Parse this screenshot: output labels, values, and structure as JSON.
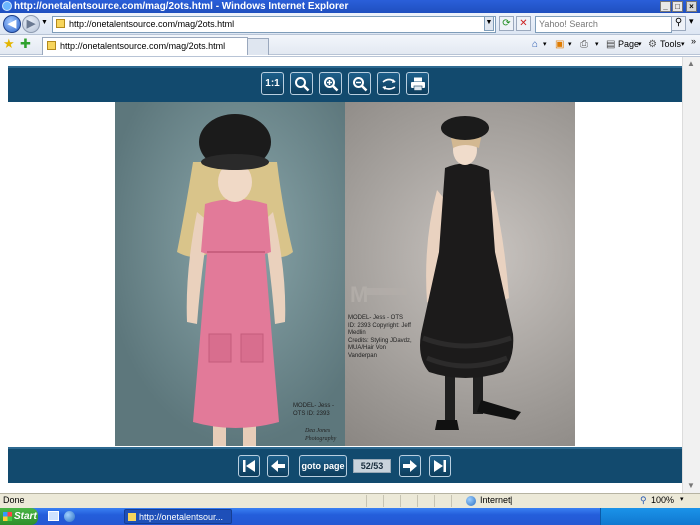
{
  "window": {
    "title": "http://onetalentsource.com/mag/2ots.html - Windows Internet Explorer",
    "minimize": "_",
    "maximize": "□",
    "close": "×"
  },
  "address_bar": {
    "url": "http://onetalentsource.com/mag/2ots.html",
    "search_placeholder": "Yahoo! Search"
  },
  "tab": {
    "title": "http://onetalentsource.com/mag/2ots.html"
  },
  "command_bar": {
    "page_label": "Page",
    "tools_label": "Tools",
    "overflow": "»"
  },
  "viewer_toolbar": {
    "actual_size_label": "1:1"
  },
  "magazine": {
    "left_caption": "MODEL- Jess -\nOTS ID: 2393",
    "left_signature": "Dea Jones\nPhotography",
    "right_caption": "MODEL- Jess - OTS\nID: 2393 Copyright: Jeff\nMedlin\nCredits: Styling JDavdz,\nMUA/Hair Von\nVanderpan",
    "right_watermark": "M"
  },
  "navigation": {
    "goto_label": "goto page",
    "page_indicator": "52/53"
  },
  "status_bar": {
    "status_text": "Done",
    "zone": "Internet",
    "zoom": "100%"
  },
  "taskbar": {
    "start_label": "Start",
    "task_label": "http://onetalentsour..."
  }
}
